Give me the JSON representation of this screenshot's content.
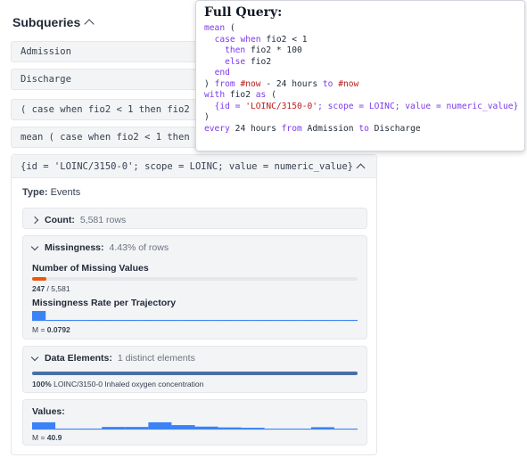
{
  "subqueries": {
    "header": "Subqueries",
    "rows": [
      "Admission",
      "Discharge",
      "( case when fio2 < 1 then fio2 * 100 else fio2 end )",
      "mean ( case when fio2 < 1 then fio2 * 100 else fio2 end ) from #now - 24 hours"
    ]
  },
  "panel": {
    "header": "{id = 'LOINC/3150-0'; scope = LOINC; value = numeric_value}",
    "type_label": "Type:",
    "type_value": "Events",
    "count": {
      "label": "Count:",
      "value": "5,581 rows"
    },
    "missingness": {
      "label": "Missingness:",
      "value": "4.43% of rows",
      "missing_title": "Number of Missing Values",
      "missing_count": "247",
      "missing_total": " / 5,581",
      "missing_fraction": 0.0443,
      "rate_title": "Missingness Rate per Trajectory",
      "mean_prefix": "M = ",
      "mean_value": "0.0792",
      "rate_hist": [
        1.0,
        0.08,
        0.08,
        0.05,
        0.02,
        0.02,
        0.02,
        0.08,
        0.03,
        0.02,
        0.02,
        0.02,
        0.02,
        0.02,
        0.02,
        0.02,
        0.02,
        0.02,
        0.02,
        0.08,
        0.03,
        0.02,
        0.02,
        0.02
      ]
    },
    "elements": {
      "label": "Data Elements:",
      "value": "1 distinct elements",
      "percent": "100%",
      "percent_fraction": 1.0,
      "element_name": " LOINC/3150-0 Inhaled oxygen concentration"
    },
    "values": {
      "label": "Values:",
      "mean_prefix": "M = ",
      "mean_value": "40.9",
      "hist": [
        0.62,
        0.04,
        0.08,
        0.22,
        0.22,
        0.62,
        0.38,
        0.25,
        0.18,
        0.15,
        0.06,
        0.04,
        0.2,
        0.04
      ]
    }
  },
  "tooltip": {
    "title": "Full Query:",
    "lines": [
      [
        [
          "kw",
          "mean"
        ],
        [
          "t",
          " ("
        ]
      ],
      [
        [
          "t",
          "  "
        ],
        [
          "kw",
          "case when"
        ],
        [
          "t",
          " fio2 < 1"
        ]
      ],
      [
        [
          "t",
          "    "
        ],
        [
          "kw",
          "then"
        ],
        [
          "t",
          " fio2 * 100"
        ]
      ],
      [
        [
          "t",
          "    "
        ],
        [
          "kw",
          "else"
        ],
        [
          "t",
          " fio2"
        ]
      ],
      [
        [
          "t",
          "  "
        ],
        [
          "kw",
          "end"
        ]
      ],
      [
        [
          "t",
          ") "
        ],
        [
          "kw",
          "from"
        ],
        [
          "t",
          " "
        ],
        [
          "ph",
          "#now"
        ],
        [
          "t",
          " - 24 hours "
        ],
        [
          "kw",
          "to"
        ],
        [
          "t",
          " "
        ],
        [
          "ph",
          "#now"
        ]
      ],
      [
        [
          "kw",
          "with"
        ],
        [
          "t",
          " fio2 "
        ],
        [
          "kw",
          "as"
        ],
        [
          "t",
          " ("
        ]
      ],
      [
        [
          "t",
          "  "
        ],
        [
          "fn",
          "{id = "
        ],
        [
          "str",
          "'LOINC/3150-0'"
        ],
        [
          "fn",
          "; scope = LOINC; value = numeric_value}"
        ]
      ],
      [
        [
          "t",
          ")"
        ]
      ],
      [
        [
          "kw",
          "every"
        ],
        [
          "t",
          " 24 hours "
        ],
        [
          "kw",
          "from"
        ],
        [
          "t",
          " Admission "
        ],
        [
          "kw",
          "to"
        ],
        [
          "t",
          " Discharge"
        ]
      ]
    ]
  },
  "colors": {
    "accent": "#3b82f6",
    "missing": "#ea580c",
    "elements_bar": "#4a6fa5",
    "keyword": "#7c3aed",
    "string": "#b91c1c"
  }
}
